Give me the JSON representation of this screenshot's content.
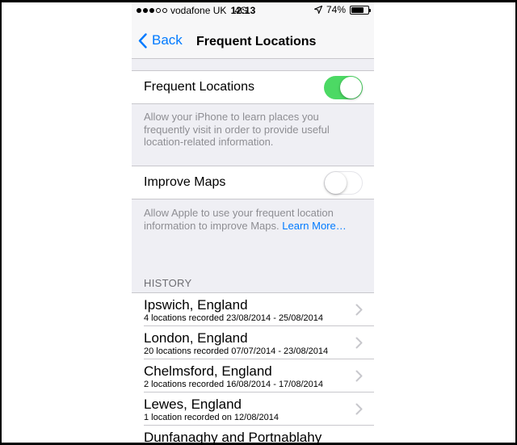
{
  "status_bar": {
    "carrier": "vodafone UK",
    "network": "4G",
    "time": "12:13",
    "battery": "74%",
    "battery_level": 0.74,
    "signal_bars_filled": 3,
    "signal_bars_total": 5
  },
  "nav": {
    "back_label": "Back",
    "title": "Frequent Locations"
  },
  "settings": {
    "frequent_locations": {
      "label": "Frequent Locations",
      "enabled": true,
      "footer": "Allow your iPhone to learn places you frequently visit in order to provide useful location-related information."
    },
    "improve_maps": {
      "label": "Improve Maps",
      "enabled": false,
      "footer": "Allow Apple to use your frequent location information to improve Maps.",
      "link": "Learn More…"
    }
  },
  "history": {
    "header": "HISTORY",
    "items": [
      {
        "title": "Ipswich, England",
        "subtitle": "4 locations recorded 23/08/2014 - 25/08/2014"
      },
      {
        "title": "London, England",
        "subtitle": "20 locations recorded 07/07/2014 - 23/08/2014"
      },
      {
        "title": "Chelmsford, England",
        "subtitle": "2 locations recorded 16/08/2014 - 17/08/2014"
      },
      {
        "title": "Lewes, England",
        "subtitle": "1 location recorded on 12/08/2014"
      },
      {
        "title": "Dunfanaghy and Portnablahy",
        "subtitle": ""
      }
    ]
  },
  "colors": {
    "accent": "#007aff",
    "toggle_on": "#4cd964",
    "footer_text": "#8e8e93",
    "group_background": "#efeff4"
  }
}
